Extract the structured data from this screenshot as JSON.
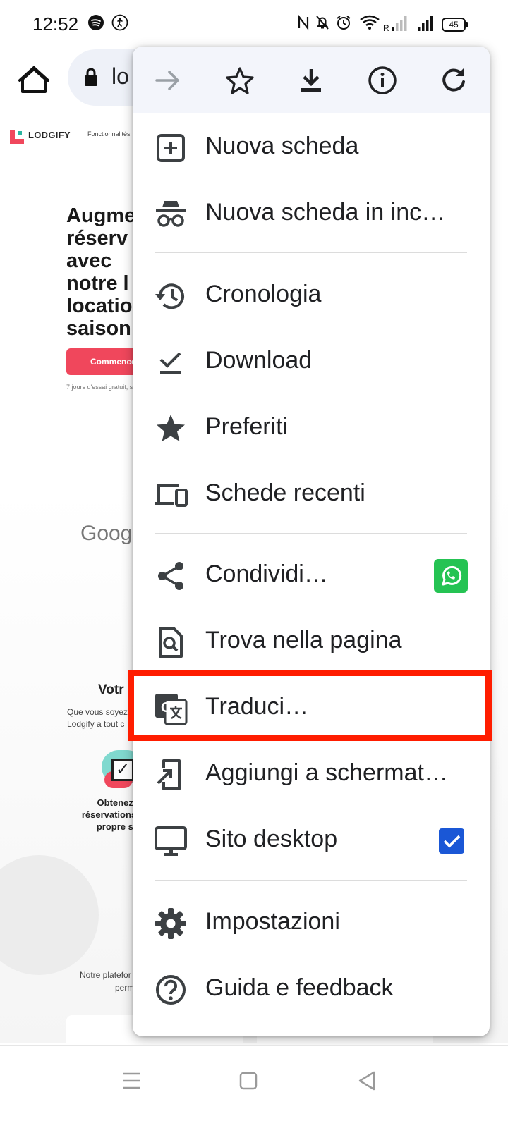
{
  "status_bar": {
    "time": "12:52",
    "icons": [
      "spotify-icon",
      "accessibility-icon",
      "nfc-icon",
      "bell-off-icon",
      "alarm-icon",
      "wifi-icon",
      "signal-roaming-icon",
      "signal-icon",
      "battery-icon"
    ],
    "roaming_label": "R",
    "battery": "45"
  },
  "toolbar": {
    "home_icon": "home-icon",
    "lock_icon": "lock-icon",
    "url_visible": "lo"
  },
  "webpage": {
    "brand": "LODGIFY",
    "nav_text": "Fonctionnalités",
    "headline_lines": [
      "Augme",
      "réserv",
      "avec",
      "notre l",
      "locatio",
      "saison"
    ],
    "cta": "Commence",
    "small_note": "7 jours d'essai gratuit, s",
    "google_text": "Googl",
    "section_title": "Votr",
    "section_lines": [
      "Que vous soyez",
      "Lodgify a tout c"
    ],
    "feature_lines": [
      "Obtenez pl",
      "réservations a",
      "propre site"
    ],
    "bottom_lines": [
      "Notre platefor",
      "perm"
    ]
  },
  "menu": {
    "top_actions": [
      {
        "name": "forward-icon",
        "enabled": false
      },
      {
        "name": "bookmark-star-icon",
        "enabled": true
      },
      {
        "name": "download-icon",
        "enabled": true
      },
      {
        "name": "info-icon",
        "enabled": true
      },
      {
        "name": "refresh-icon",
        "enabled": true
      }
    ],
    "items": [
      {
        "label": "Nuova scheda",
        "icon": "new-tab-icon"
      },
      {
        "label": "Nuova scheda in inc…",
        "icon": "incognito-icon"
      },
      {
        "label": "Cronologia",
        "icon": "history-icon"
      },
      {
        "label": "Download",
        "icon": "download-check-icon"
      },
      {
        "label": "Preferiti",
        "icon": "star-icon"
      },
      {
        "label": "Schede recenti",
        "icon": "devices-icon"
      },
      {
        "label": "Condividi…",
        "icon": "share-icon",
        "app_badge": "whatsapp-icon"
      },
      {
        "label": "Trova nella pagina",
        "icon": "find-in-page-icon"
      },
      {
        "label": "Traduci…",
        "icon": "translate-icon",
        "highlighted": true
      },
      {
        "label": "Aggiungi a schermat…",
        "icon": "add-to-home-icon"
      },
      {
        "label": "Sito desktop",
        "icon": "desktop-icon",
        "checked": true
      },
      {
        "label": "Impostazioni",
        "icon": "settings-icon"
      },
      {
        "label": "Guida e feedback",
        "icon": "help-icon"
      }
    ]
  },
  "nav_bar": {
    "buttons": [
      "recents-icon",
      "home-square-icon",
      "back-triangle-icon"
    ]
  },
  "colors": {
    "highlight": "#ff1d00",
    "checkbox": "#1a57d6",
    "whatsapp": "#25c353",
    "cta": "#f0475c",
    "menu_top_bg": "#f3f5fb"
  }
}
